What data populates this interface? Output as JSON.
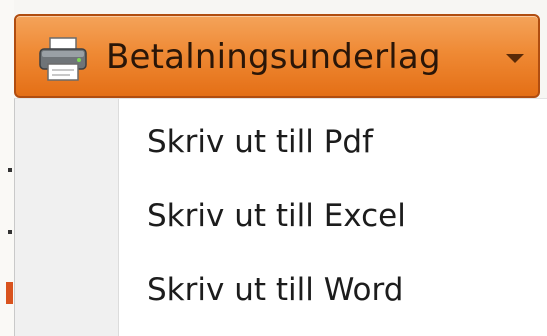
{
  "button": {
    "label": "Betalningsunderlag",
    "icon": "printer-icon",
    "caret_icon": "chevron-down-icon",
    "accent_color": "#ef8a35",
    "border_color": "#b04d10"
  },
  "menu": {
    "items": [
      {
        "label": "Skriv ut till Pdf"
      },
      {
        "label": "Skriv ut till Excel"
      },
      {
        "label": "Skriv ut till Word"
      }
    ]
  }
}
